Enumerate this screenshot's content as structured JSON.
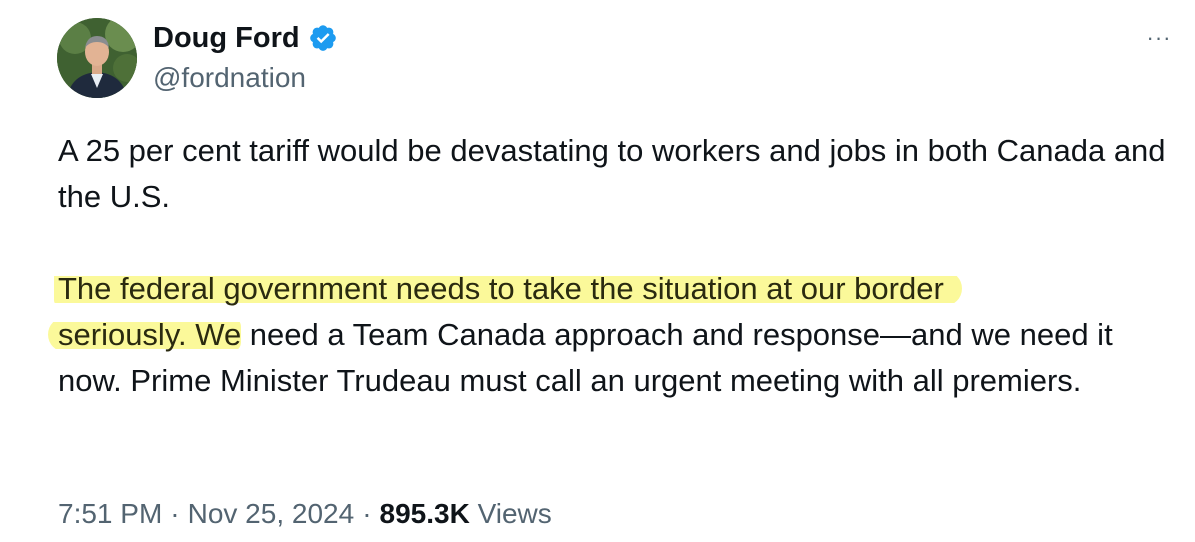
{
  "author": {
    "display_name": "Doug Ford",
    "handle": "@fordnation",
    "verified_icon": "verified-badge-icon",
    "avatar_icon": "profile-photo"
  },
  "more_menu": {
    "label": "···",
    "icon": "more-options-icon"
  },
  "tweet": {
    "paragraph1": "A 25 per cent tariff would be devastating to workers and jobs in both Canada and the U.S.",
    "paragraph2_highlight_line1": "The federal government needs to take the situation at our border",
    "paragraph2_highlight_line2": "seriously. We",
    "paragraph2_rest": " need a Team Canada approach and response—and we need it now. Prime Minister Trudeau must call an urgent meeting with all premiers."
  },
  "meta": {
    "time": "7:51 PM",
    "sep1": "·",
    "date": "Nov 25, 2024",
    "sep2": "·",
    "views_count": "895.3K",
    "views_label": "Views"
  },
  "colors": {
    "text_primary": "#0f1419",
    "text_secondary": "#536471",
    "verified_blue": "#1d9bf0",
    "highlight": "#fbf99a"
  }
}
